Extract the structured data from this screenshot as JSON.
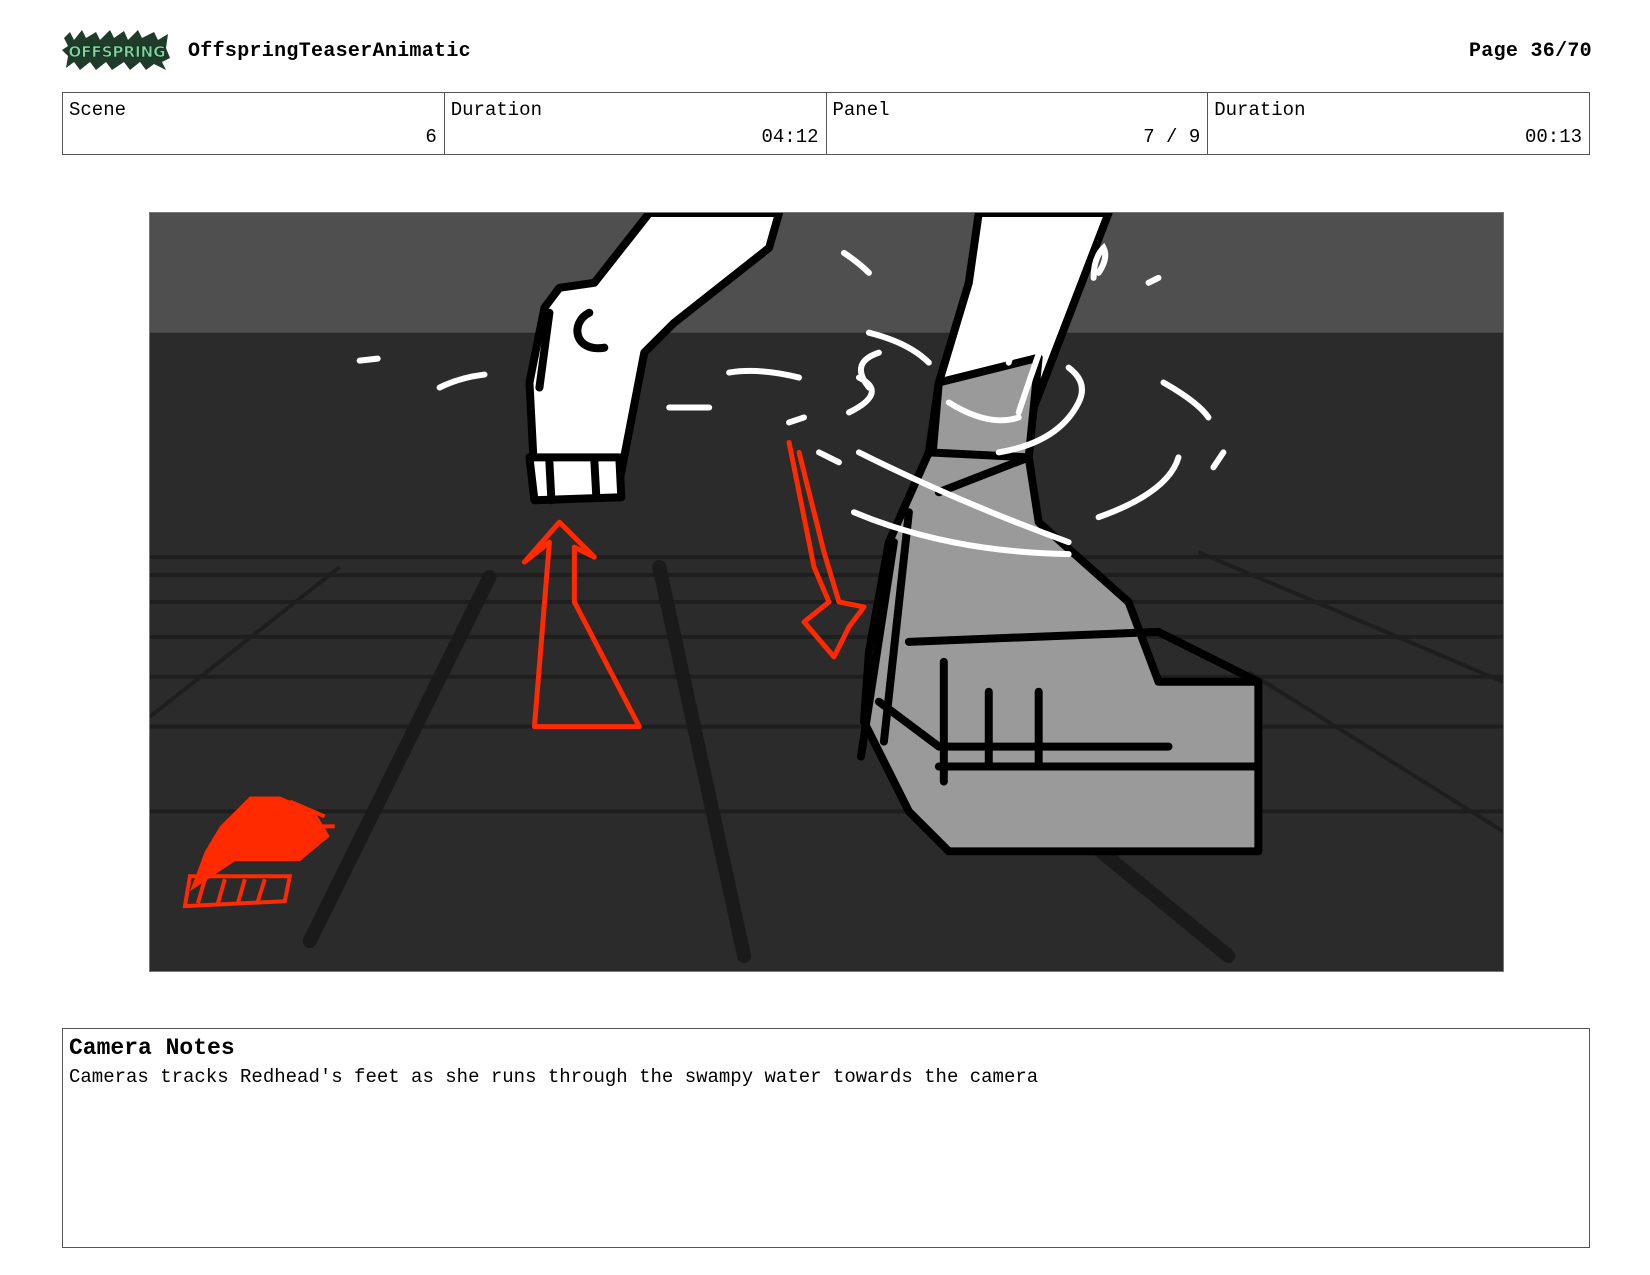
{
  "header": {
    "logo_text": "OFFSPRING",
    "project_title": "OffspringTeaserAnimatic",
    "page_label": "Page 36/70"
  },
  "info": {
    "scene_label": "Scene",
    "scene_value": "6",
    "scene_duration_label": "Duration",
    "scene_duration_value": "04:12",
    "panel_label": "Panel",
    "panel_value": "7 / 9",
    "panel_duration_label": "Duration",
    "panel_duration_value": "00:13"
  },
  "notes": {
    "title": "Camera Notes",
    "text": "Cameras tracks Redhead's feet as she runs through the swampy water towards the camera"
  },
  "colors": {
    "annotation_red": "#ff2a00",
    "background_dark": "#2b2b2b",
    "horizon": "#4f4f4f"
  }
}
